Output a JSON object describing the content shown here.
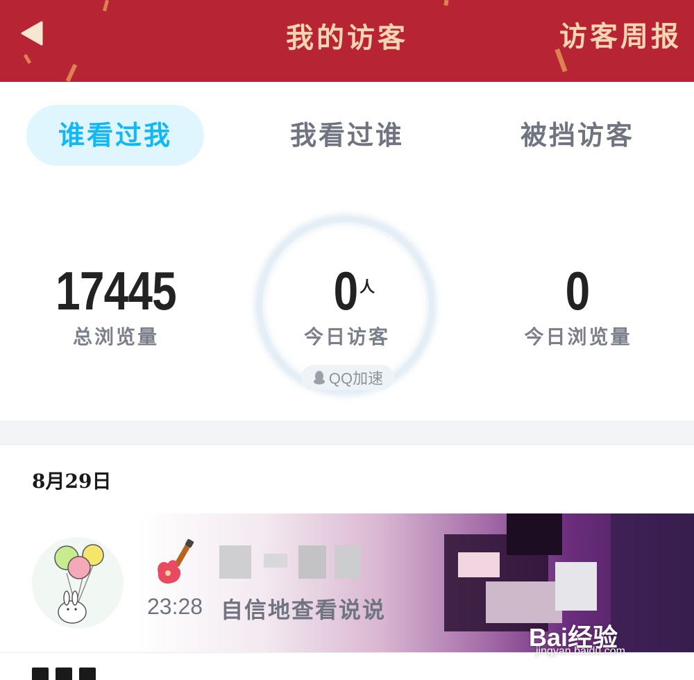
{
  "header": {
    "title": "我的访客",
    "right_action": "访客周报",
    "background_color": "#b72434",
    "text_color": "#f6d6b2"
  },
  "tabs": [
    {
      "label": "谁看过我",
      "active": true
    },
    {
      "label": "我看过谁",
      "active": false
    },
    {
      "label": "被挡访客",
      "active": false
    }
  ],
  "stats": {
    "total_views": {
      "value": "17445",
      "label": "总浏览量"
    },
    "today_visitors": {
      "value": "0",
      "unit": "人",
      "label": "今日访客"
    },
    "today_views": {
      "value": "0",
      "label": "今日浏览量"
    },
    "speed_badge": "QQ加速"
  },
  "date_label": "8月29日",
  "visitors": [
    {
      "icon": "guitar-icon",
      "time": "23:28",
      "action": "自信地查看说说"
    }
  ],
  "watermark": {
    "text": "Bai经验",
    "url": "jingyan.baidu.com"
  }
}
